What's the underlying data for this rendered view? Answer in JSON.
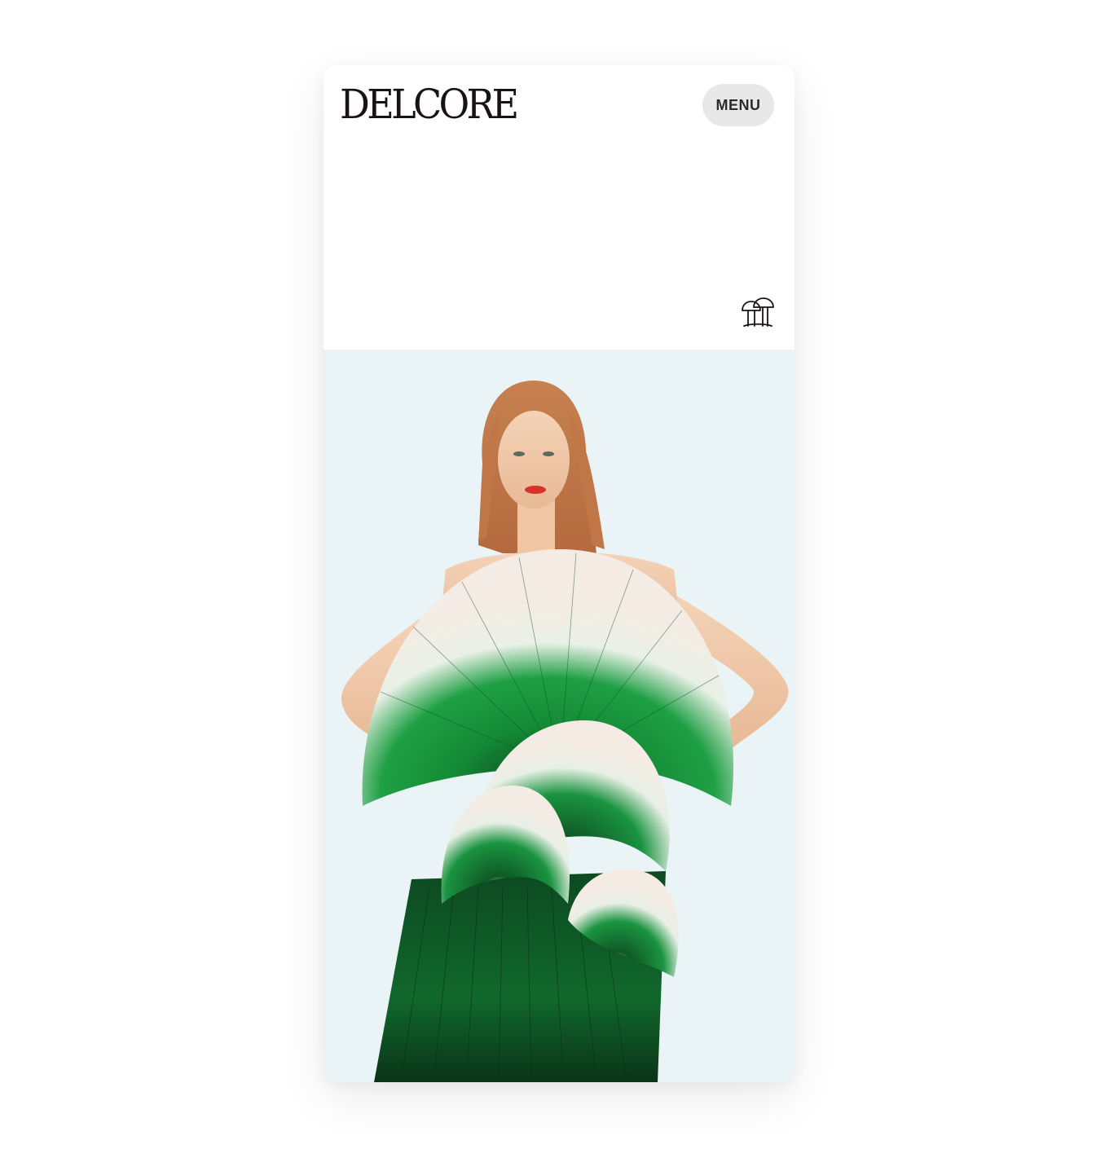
{
  "brand": {
    "logo_text": "DELCORE",
    "logo_icon": "mushroom-icon"
  },
  "header": {
    "menu_label": "MENU"
  },
  "hero": {
    "image_icon": "hero-photo",
    "background_color": "#eaf4f7",
    "garment_color": "#1b8a3a"
  }
}
